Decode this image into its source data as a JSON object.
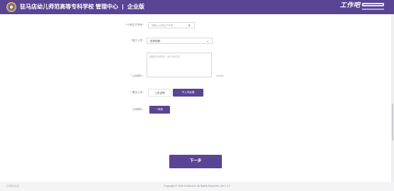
{
  "header": {
    "school_name": "驻马店幼儿师范高等专科学校",
    "center_label": "管理中心",
    "separator": "|",
    "section_label": "企业版",
    "brand_name": "工作吧",
    "background_color": "#5a4494"
  },
  "form": {
    "plan_field": {
      "label": "计划生产年份",
      "placeholder": "请输入计划生产年份",
      "unit": "年",
      "required": true
    },
    "type_field": {
      "label": "施工人员",
      "value": "选择视频",
      "icon": "chevron-down-icon",
      "required": true
    },
    "intro_field": {
      "label": "公司简介",
      "placeholder": "请填写公司简介（50-1000字）",
      "counter": "0/1000"
    },
    "upload_field": {
      "label": "是否上传",
      "options": [
        "上传证照",
        "不上传证照"
      ],
      "selected_index": 1,
      "required": true
    },
    "photo_field": {
      "label": "公司照片",
      "button_label": "+添加"
    },
    "next_button_label": "下一步"
  },
  "footer": {
    "left_text": "已添加认证",
    "copyright": "Copyright © 2023 GoWork.hi. All Rights Reserved. Ver 1.0.7"
  },
  "colors": {
    "accent": "#5a4494",
    "required": "#e34a4a",
    "page_background": "#f4f4f6"
  }
}
